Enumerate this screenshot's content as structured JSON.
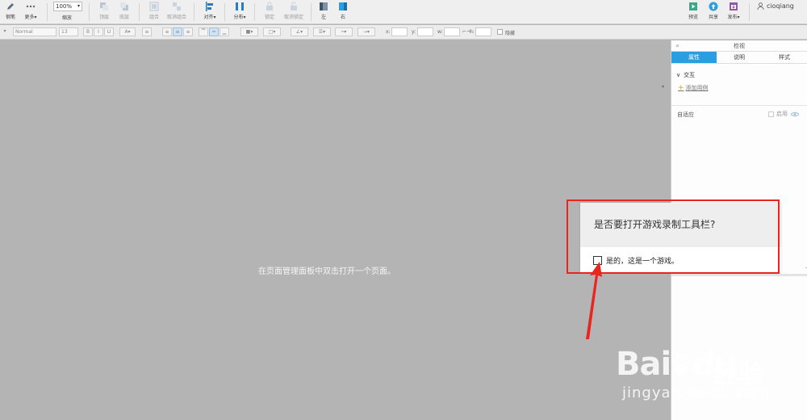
{
  "toolbar": {
    "edit_label": "钢笔",
    "more_label": "更多▾",
    "zoom_value": "100%",
    "zoom_label": "缩放",
    "top_label": "顶层",
    "bottom_label": "底层",
    "group_label": "组合",
    "ungroup_label": "取消组合",
    "align_label": "对齐▾",
    "distribute_label": "分布▾",
    "lock_label": "锁定",
    "unlock_label": "取消锁定",
    "left_label": "左",
    "right_label": "右",
    "preview_label": "预览",
    "share_label": "共享",
    "publish_label": "发布▾",
    "username": "cioqiang"
  },
  "formatbar": {
    "style_value": "Normal",
    "size_value": "13",
    "bold": "B",
    "italic": "I",
    "underline": "U",
    "x_label": "x:",
    "y_label": "y:",
    "w_label": "w:",
    "h_label": "h:",
    "hide_label": "隐藏"
  },
  "canvas": {
    "hint": "在页面管理面板中双击打开一个页面。",
    "corner": "▾"
  },
  "panel": {
    "title": "检视",
    "collapse": "«",
    "tabs": [
      "属性",
      "说明",
      "样式"
    ],
    "interaction_title": "交互",
    "add_case": "添加用例",
    "adaptive_label": "自适应",
    "enable_label": "启用"
  },
  "dialog": {
    "question": "是否要打开游戏录制工具栏?",
    "checkbox_label": "是的，这是一个游戏。"
  },
  "watermark": {
    "brand": "Bai",
    "brand2": "du",
    "cn": "经验",
    "url": "jingyan.baidu.com"
  },
  "colors": {
    "accent_blue": "#2a9ee0",
    "highlight_red": "#e8261f",
    "canvas_gray": "#b4b4b4"
  }
}
